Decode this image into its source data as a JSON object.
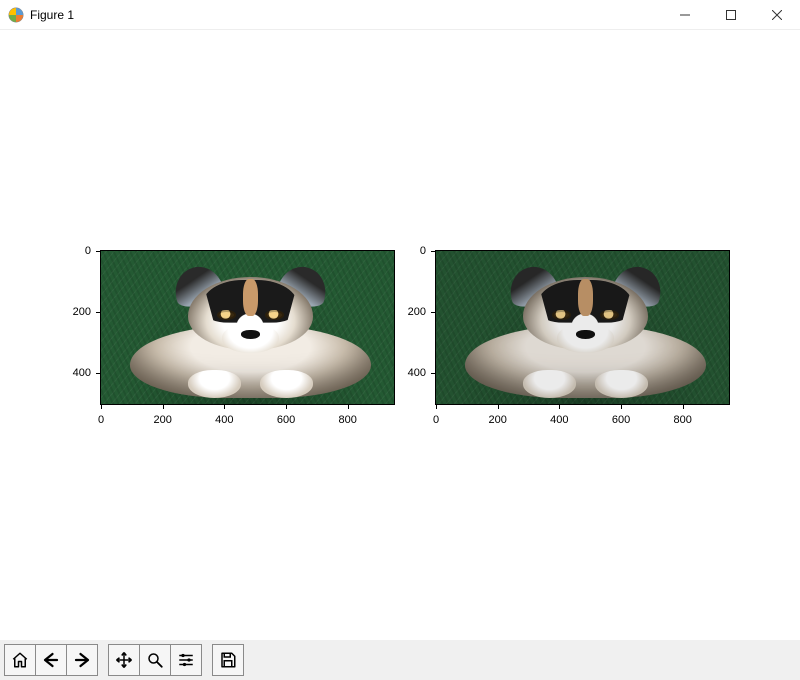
{
  "window": {
    "title": "Figure 1",
    "controls": {
      "minimize": "minimize",
      "maximize": "maximize",
      "close": "close"
    }
  },
  "toolbar": {
    "home": "Home",
    "back": "Back",
    "forward": "Forward",
    "pan": "Pan",
    "zoom": "Zoom",
    "configure": "Configure subplots",
    "save": "Save"
  },
  "chart_data": [
    {
      "type": "image",
      "position": "left",
      "description": "husky puppy on grass (original)",
      "x_ticks": [
        0,
        200,
        400,
        600,
        800
      ],
      "y_ticks": [
        0,
        200,
        400
      ],
      "xlim": [
        0,
        950
      ],
      "ylim": [
        500,
        0
      ]
    },
    {
      "type": "image",
      "position": "right",
      "description": "husky puppy on grass (processed copy)",
      "x_ticks": [
        0,
        200,
        400,
        600,
        800
      ],
      "y_ticks": [
        0,
        200,
        400
      ],
      "xlim": [
        0,
        950
      ],
      "ylim": [
        500,
        0
      ]
    }
  ],
  "ticks": {
    "left": {
      "x": [
        {
          "v": 0,
          "label": "0"
        },
        {
          "v": 200,
          "label": "200"
        },
        {
          "v": 400,
          "label": "400"
        },
        {
          "v": 600,
          "label": "600"
        },
        {
          "v": 800,
          "label": "800"
        }
      ],
      "y": [
        {
          "v": 0,
          "label": "0"
        },
        {
          "v": 200,
          "label": "200"
        },
        {
          "v": 400,
          "label": "400"
        }
      ]
    },
    "right": {
      "x": [
        {
          "v": 0,
          "label": "0"
        },
        {
          "v": 200,
          "label": "200"
        },
        {
          "v": 400,
          "label": "400"
        },
        {
          "v": 600,
          "label": "600"
        },
        {
          "v": 800,
          "label": "800"
        }
      ],
      "y": [
        {
          "v": 0,
          "label": "0"
        },
        {
          "v": 200,
          "label": "200"
        },
        {
          "v": 400,
          "label": "400"
        }
      ]
    }
  }
}
